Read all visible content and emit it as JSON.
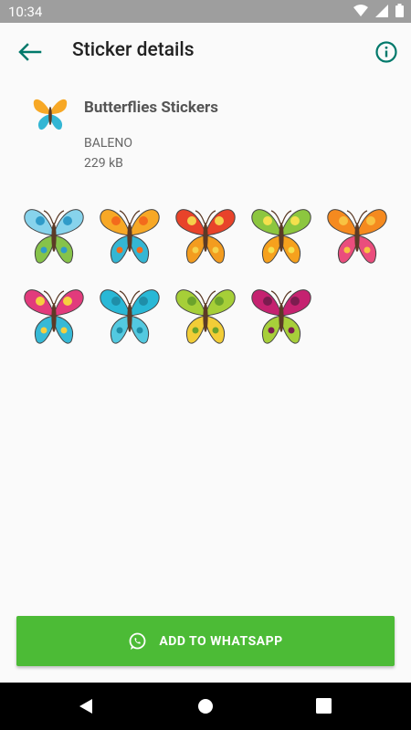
{
  "status": {
    "time": "10:34"
  },
  "appbar": {
    "title": "Sticker details",
    "back_icon": "arrow-back-icon",
    "info_icon": "info-icon"
  },
  "pack": {
    "name": "Butterflies Stickers",
    "publisher": "BALENO",
    "size": "229 kB"
  },
  "stickers": [
    {
      "wing1": "#87d3ec",
      "wing2": "#86c34a",
      "accent": "#2f9bc9"
    },
    {
      "wing1": "#f7a826",
      "wing2": "#34b6d4",
      "accent": "#f36b1c"
    },
    {
      "wing1": "#e8432a",
      "wing2": "#f39c1f",
      "accent": "#f5d14b"
    },
    {
      "wing1": "#8cc63f",
      "wing2": "#f6a11d",
      "accent": "#f4e04d"
    },
    {
      "wing1": "#f58a1f",
      "wing2": "#ea4d7d",
      "accent": "#f8c242"
    },
    {
      "wing1": "#e23b7c",
      "wing2": "#36b9d6",
      "accent": "#f6cf3f"
    },
    {
      "wing1": "#29b8d6",
      "wing2": "#53c9e0",
      "accent": "#1f8ea8"
    },
    {
      "wing1": "#a6cf38",
      "wing2": "#f2cd37",
      "accent": "#6ba32c"
    },
    {
      "wing1": "#c52270",
      "wing2": "#a7cf3a",
      "accent": "#7b1c4f"
    }
  ],
  "actions": {
    "add_label": "ADD TO WHATSAPP"
  },
  "colors": {
    "accent": "#00796b",
    "button": "#4cbb36"
  }
}
